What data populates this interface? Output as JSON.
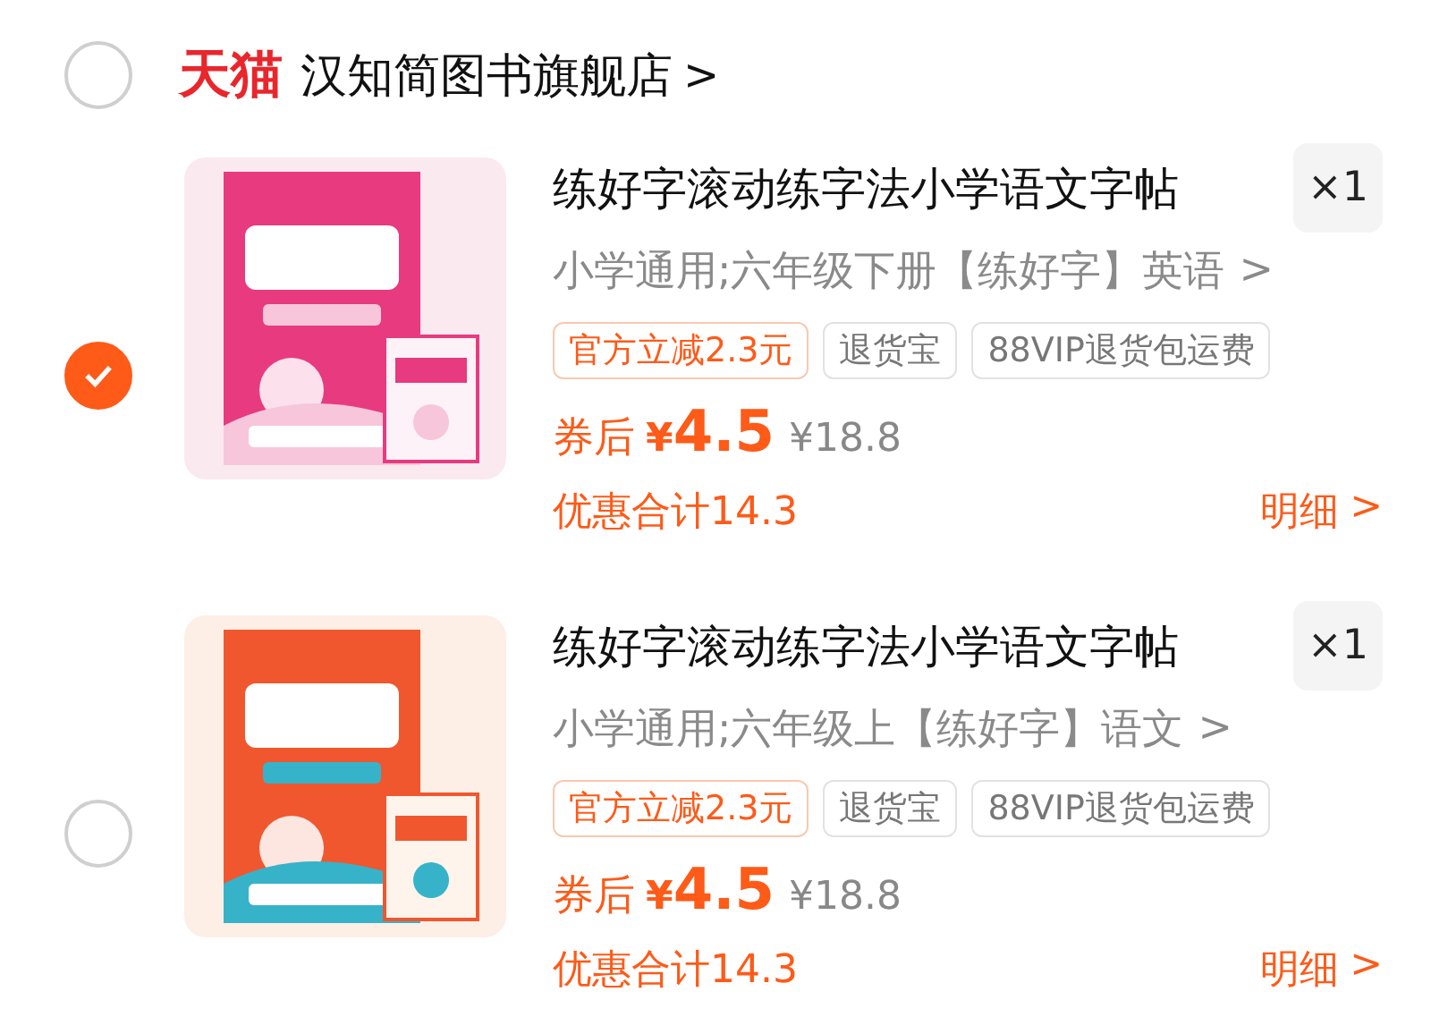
{
  "store": {
    "selected": false,
    "logo": "天猫",
    "name": "汉知简图书旗舰店",
    "arrow": ">"
  },
  "items": [
    {
      "selected": true,
      "title": "练好字滚动练字法小学语文字帖",
      "quantity": "×1",
      "spec": "小学通用;六年级下册【练好字】英语",
      "spec_arrow": ">",
      "tags": [
        {
          "kind": "promo",
          "text": "官方立减2.3元"
        },
        {
          "kind": "service",
          "text": "退货宝"
        },
        {
          "kind": "service",
          "text": "88VIP退货包运费"
        }
      ],
      "price_label": "券后",
      "currency": "¥",
      "price": "4.5",
      "original_price": "¥18.8",
      "discount": "优惠合计14.3",
      "details": "明细",
      "details_arrow": ">"
    },
    {
      "selected": false,
      "title": "练好字滚动练字法小学语文字帖",
      "quantity": "×1",
      "spec": "小学通用;六年级上【练好字】语文",
      "spec_arrow": ">",
      "tags": [
        {
          "kind": "promo",
          "text": "官方立减2.3元"
        },
        {
          "kind": "service",
          "text": "退货宝"
        },
        {
          "kind": "service",
          "text": "88VIP退货包运费"
        }
      ],
      "price_label": "券后",
      "currency": "¥",
      "price": "4.5",
      "original_price": "¥18.8",
      "discount": "优惠合计14.3",
      "details": "明细",
      "details_arrow": ">"
    }
  ]
}
